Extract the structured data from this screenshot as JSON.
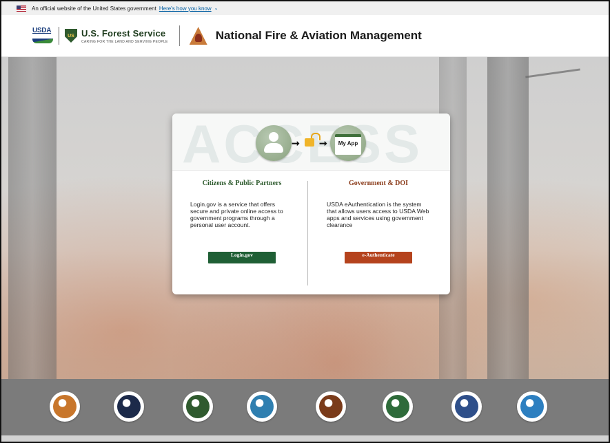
{
  "gov_banner": {
    "text": "An official website of the United States government",
    "link": "Here's how you know",
    "chevron": "⌄"
  },
  "header": {
    "usda": "USDA",
    "fs_shield_text": "US",
    "fs_title": "U.S. Forest Service",
    "fs_tagline": "CARING FOR THE LAND AND SERVING PEOPLE",
    "nfam_title": "National Fire & Aviation Management"
  },
  "card": {
    "banner_word": "ACCESS",
    "arrow": "➞",
    "app_label": "My App",
    "left": {
      "title": "Citizens & Public Partners",
      "description": "Login.gov is a service that offers secure and private online access to government programs through a personal user account.",
      "button": "Login.gov"
    },
    "right": {
      "title": "Government & DOI",
      "description": "USDA eAuthentication is the system that allows users access to USDA Web apps and services using government clearance",
      "button": "e-Authenticate"
    }
  },
  "agencies": [
    {
      "name": "interior-seal-icon",
      "color": "#c8762b"
    },
    {
      "name": "eagle-seal-icon",
      "color": "#1c2a4a"
    },
    {
      "name": "forest-service-shield-icon",
      "color": "#2f5a2e"
    },
    {
      "name": "blm-seal-icon",
      "color": "#2f7fb0"
    },
    {
      "name": "nps-arrowhead-icon",
      "color": "#7a3b1a"
    },
    {
      "name": "forestry-tree-seal-icon",
      "color": "#2e6b3a"
    },
    {
      "name": "defense-seal-icon",
      "color": "#2e4f8a"
    },
    {
      "name": "fish-wildlife-shield-icon",
      "color": "#2d7fc0"
    }
  ]
}
